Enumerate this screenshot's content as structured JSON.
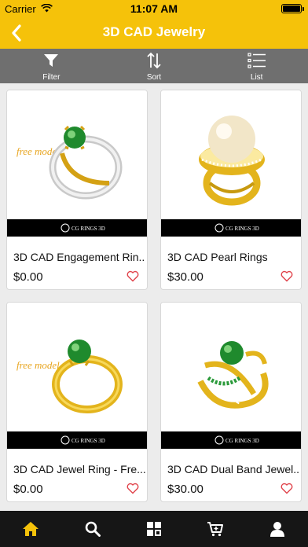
{
  "status_bar": {
    "carrier": "Carrier",
    "time": "11:07 AM"
  },
  "nav": {
    "title": "3D CAD Jewelry"
  },
  "toolbar": {
    "filter": "Filter",
    "sort": "Sort",
    "list": "List"
  },
  "products": [
    {
      "title": "3D CAD Engagement Rin...",
      "price": "$0.00",
      "watermark": "free model",
      "metal": "white-gold",
      "stone": "emerald"
    },
    {
      "title": "3D CAD Pearl Rings",
      "price": "$30.00",
      "watermark": "",
      "metal": "yellow-gold",
      "stone": "pearl"
    },
    {
      "title": "3D CAD Jewel Ring - Fre...",
      "price": "$0.00",
      "watermark": "free model",
      "metal": "yellow-gold",
      "stone": "emerald"
    },
    {
      "title": "3D CAD Dual Band Jewel...",
      "price": "$30.00",
      "watermark": "",
      "metal": "yellow-gold",
      "stone": "emerald"
    }
  ],
  "brand_strip_text": "CG RINGS 3D",
  "tabs": [
    "home",
    "search",
    "categories",
    "cart",
    "account"
  ],
  "colors": {
    "accent": "#f5c20a",
    "toolbar": "#6f6f6f",
    "tabbar": "#161616",
    "heart": "#e0434b"
  },
  "icons": {
    "nav": "chevron-left-icon",
    "toolbar": [
      "filter-icon",
      "sort-icon",
      "list-icon"
    ],
    "tabs": [
      "home-icon",
      "search-icon",
      "grid-icon",
      "cart-icon",
      "user-icon"
    ]
  }
}
